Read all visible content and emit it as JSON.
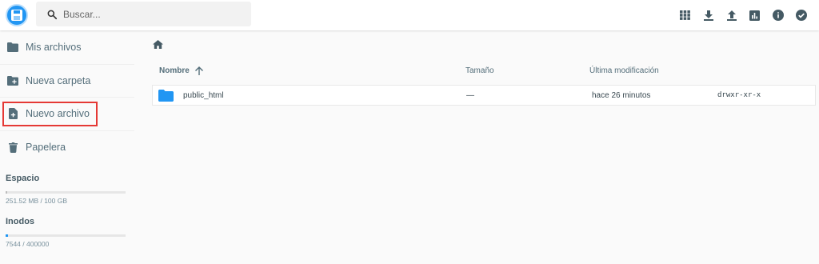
{
  "search": {
    "placeholder": "Buscar..."
  },
  "header_icons": [
    "grid-view-icon",
    "download-icon",
    "upload-icon",
    "info-chart-icon",
    "info-icon",
    "check-circle-icon"
  ],
  "sidebar": {
    "items": [
      {
        "label": "Mis archivos",
        "icon": "folder-icon"
      },
      {
        "label": "Nueva carpeta",
        "icon": "new-folder-icon"
      },
      {
        "label": "Nuevo archivo",
        "icon": "new-file-icon"
      },
      {
        "label": "Papelera",
        "icon": "trash-icon"
      }
    ],
    "space": {
      "title": "Espacio",
      "text": "251.52 MB / 100 GB",
      "fraction": 0.0025
    },
    "inodes": {
      "title": "Inodos",
      "text": "7544 / 400000",
      "fraction": 0.019
    }
  },
  "list": {
    "columns": {
      "name": "Nombre",
      "size": "Tamaño",
      "modified": "Última modificación"
    },
    "rows": [
      {
        "name": "public_html",
        "size": "—",
        "modified": "hace 26 minutos",
        "permissions": "drwxr-xr-x",
        "icon": "folder-icon"
      }
    ]
  },
  "colors": {
    "accent": "#2196f3",
    "highlight": "#e53935",
    "text": "#546e7a"
  }
}
